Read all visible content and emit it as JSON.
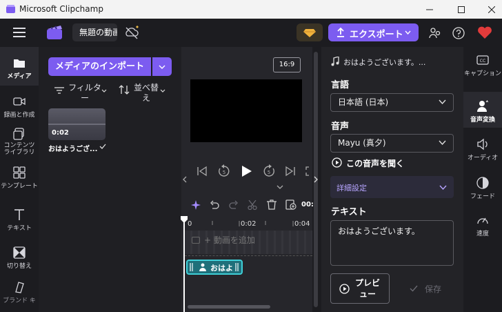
{
  "window": {
    "title": "Microsoft Clipchamp"
  },
  "header": {
    "project_name": "無題の動画",
    "export_label": "エクスポート"
  },
  "left_rail": {
    "items": [
      {
        "label": "メディア"
      },
      {
        "label": "録画と作成"
      },
      {
        "label": "コンテンツ ライブラリ"
      },
      {
        "label": "テンプレート"
      },
      {
        "label": "テキスト"
      },
      {
        "label": "切り替え"
      },
      {
        "label": "ブランド キ"
      }
    ]
  },
  "media": {
    "import_label": "メディアのインポート",
    "filter_label": "フィルター",
    "sort_label": "並べ替え",
    "item": {
      "duration": "0:02",
      "name": "おはようござ..."
    }
  },
  "preview": {
    "aspect_ratio": "16:9"
  },
  "timeline": {
    "time_display": "00:",
    "ruler": [
      "0",
      "0:02",
      "0:04"
    ],
    "add_video_label": "+ 動画を追加",
    "audio_clip_label": "おはよ"
  },
  "right_panel": {
    "track_title": "おはようございます。...",
    "language_label": "言語",
    "language_value": "日本語 (日本)",
    "voice_label": "音声",
    "voice_value": "Mayu (真夕)",
    "listen_label": "この音声を聞く",
    "advanced_label": "詳細設定",
    "text_label": "テキスト",
    "text_value": "おはようございます。",
    "preview_label": "プレビュー",
    "save_label": "保存"
  },
  "right_rail": {
    "items": [
      {
        "label": "キャプション"
      },
      {
        "label": "音声変換"
      },
      {
        "label": "オーディオ"
      },
      {
        "label": "フェード"
      },
      {
        "label": "速度"
      }
    ]
  },
  "colors": {
    "accent": "#7c5cf0",
    "clip": "#1f6f7a",
    "background": "#1f1f23"
  }
}
